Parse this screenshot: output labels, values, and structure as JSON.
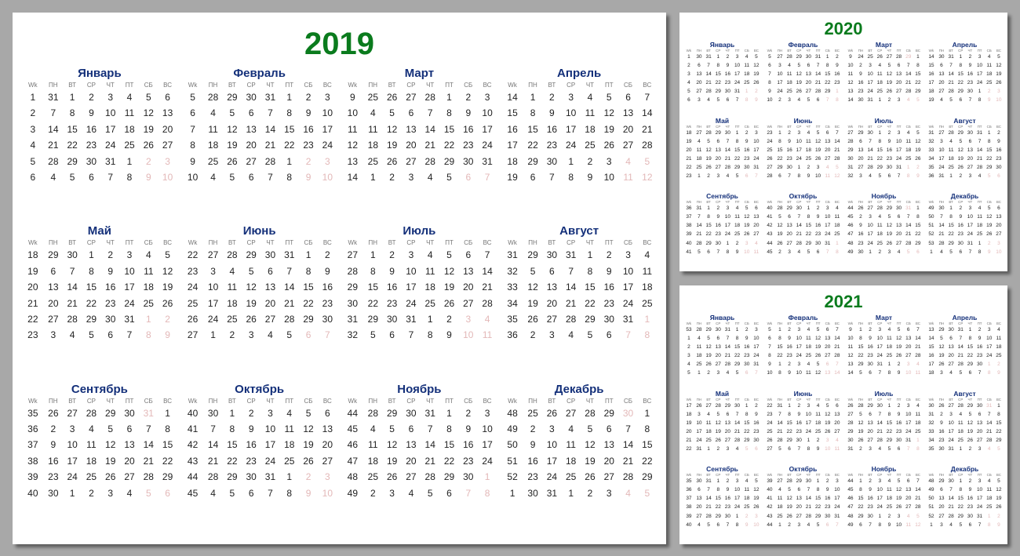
{
  "wkLabel": "Wk",
  "dayHeaders": [
    "ПН",
    "ВТ",
    "СР",
    "ЧТ",
    "ПТ",
    "СБ",
    "ВС"
  ],
  "monthNames": [
    "Январь",
    "Февраль",
    "Март",
    "Апрель",
    "Май",
    "Июнь",
    "Июль",
    "Август",
    "Сентябрь",
    "Октябрь",
    "Ноябрь",
    "Декабрь"
  ],
  "years": [
    {
      "year": 2019,
      "start": 1,
      "panel": "main"
    },
    {
      "year": 2020,
      "start": 2,
      "panel": "sm2020"
    },
    {
      "year": 2021,
      "start": 4,
      "panel": "sm2021"
    }
  ]
}
